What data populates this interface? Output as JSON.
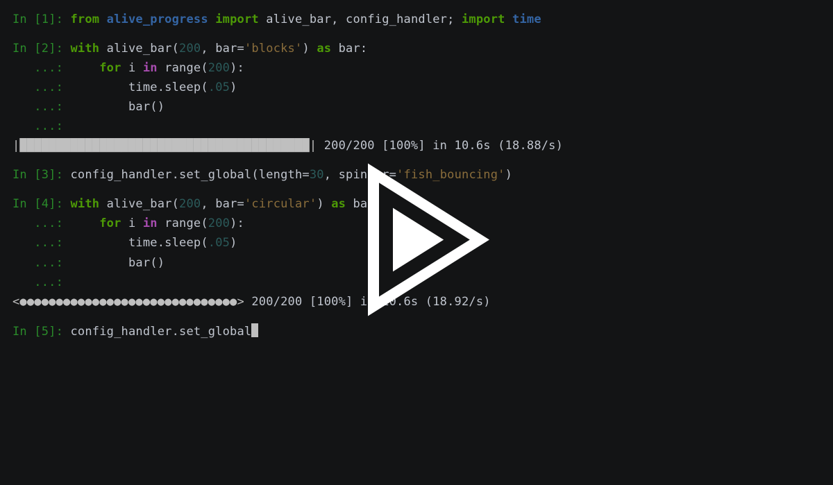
{
  "prompts": {
    "in1": "In [1]: ",
    "in2": "In [2]: ",
    "in3": "In [3]: ",
    "in4": "In [4]: ",
    "in5": "In [5]: ",
    "cont": "   ...: "
  },
  "cell1": {
    "from": "from",
    "module": "alive_progress",
    "import": "import",
    "items": " alive_bar, config_handler; ",
    "import2": "import",
    "time": "time"
  },
  "cell2": {
    "with": "with",
    "call": " alive_bar(",
    "n": "200",
    "comma": ", bar=",
    "str": "'blocks'",
    "close": ") ",
    "as": "as",
    "var": " bar:",
    "for": "for",
    "i": " i ",
    "in": "in",
    "range": " range(",
    "rnum": "200",
    "rclose": "):",
    "indent": "    ",
    "indent2": "        ",
    "sleep": "time.sleep(",
    "sleepn": ".05",
    "sleepc": ")",
    "barcall": "bar()"
  },
  "progress1": {
    "bar": "|████████████████████████████████████████| ",
    "stats": "200/200 [100%] in 10.6s (18.88/s)"
  },
  "cell3": {
    "call1": "config_handler.",
    "method": "set_global",
    "open": "(length=",
    "len": "30",
    "comma": ", spinner=",
    "str": "'fish_bouncing'",
    "close": ")"
  },
  "cell4": {
    "with": "with",
    "call": " alive_bar(",
    "n": "200",
    "comma": ", bar=",
    "str": "'circular'",
    "close": ") ",
    "as": "as",
    "var": " bar:",
    "for": "for",
    "i": " i ",
    "in": "in",
    "range": " range(",
    "rnum": "200",
    "rclose": "):",
    "sleep": "time.sleep(",
    "sleepn": ".05",
    "sleepc": ")",
    "barcall": "bar()"
  },
  "progress2": {
    "bar": "<●●●●●●●●●●●●●●●●●●●●●●●●●●●●●●> ",
    "stats": "200/200 [100%] in 10.6s (18.92/s)"
  },
  "cell5": {
    "call": "config_handler.set_global"
  }
}
